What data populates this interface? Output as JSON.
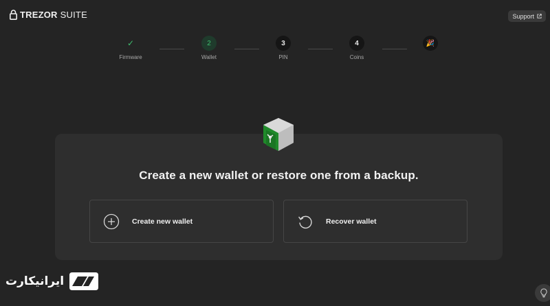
{
  "header": {
    "logo_brand": "TREZOR",
    "logo_product": "SUITE",
    "support_label": "Support"
  },
  "stepper": {
    "steps": [
      {
        "label": "Firmware",
        "number": "✓",
        "state": "done"
      },
      {
        "label": "Wallet",
        "number": "2",
        "state": "active"
      },
      {
        "label": "PIN",
        "number": "3",
        "state": "future"
      },
      {
        "label": "Coins",
        "number": "4",
        "state": "future"
      },
      {
        "label": "",
        "number": "🎉",
        "state": "future"
      }
    ]
  },
  "main": {
    "heading": "Create a new wallet or restore one from a backup.",
    "options": [
      {
        "label": "Create new wallet",
        "icon": "plus-circle-icon"
      },
      {
        "label": "Recover wallet",
        "icon": "recover-arrow-icon"
      }
    ]
  },
  "watermark": {
    "text": "ایرانیکارت"
  },
  "colors": {
    "background": "#242424",
    "card": "#2e2e2e",
    "accent_green": "#3fbf6f",
    "device_green": "#1f8a2a"
  }
}
